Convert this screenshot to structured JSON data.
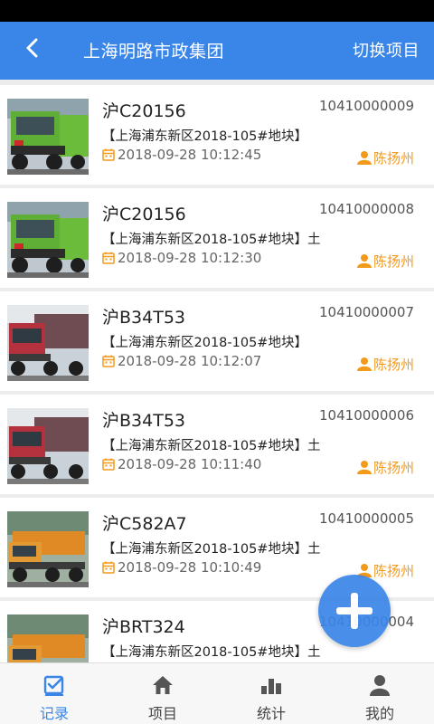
{
  "header": {
    "title": "上海明路市政集团",
    "switch_label": "切换项目"
  },
  "records": [
    {
      "plate": "沪C20156",
      "code": "10410000009",
      "site": "【上海浦东新区2018-105#地块】",
      "time": "2018-09-28 10:12:45",
      "person": "陈扬州",
      "photo": "green-truck"
    },
    {
      "plate": "沪C20156",
      "code": "10410000008",
      "site": "【上海浦东新区2018-105#地块】土",
      "time": "2018-09-28 10:12:30",
      "person": "陈扬州",
      "photo": "green-truck"
    },
    {
      "plate": "沪B34T53",
      "code": "10410000007",
      "site": "【上海浦东新区2018-105#地块】",
      "time": "2018-09-28 10:12:07",
      "person": "陈扬州",
      "photo": "red-truck"
    },
    {
      "plate": "沪B34T53",
      "code": "10410000006",
      "site": "【上海浦东新区2018-105#地块】土",
      "time": "2018-09-28 10:11:40",
      "person": "陈扬州",
      "photo": "red-truck"
    },
    {
      "plate": "沪C582A7",
      "code": "10410000005",
      "site": "【上海浦东新区2018-105#地块】土",
      "time": "2018-09-28 10:10:49",
      "person": "陈扬州",
      "photo": "orange-truck"
    },
    {
      "plate": "沪BRT324",
      "code": "10410000004",
      "site": "【上海浦东新区2018-105#地块】土",
      "time": "",
      "person": "",
      "photo": "orange-truck"
    }
  ],
  "tabs": [
    {
      "label": "记录",
      "icon": "check-square-icon",
      "active": true
    },
    {
      "label": "项目",
      "icon": "home-icon",
      "active": false
    },
    {
      "label": "统计",
      "icon": "bar-chart-icon",
      "active": false
    },
    {
      "label": "我的",
      "icon": "user-icon",
      "active": false
    }
  ],
  "colors": {
    "primary": "#3a86e8",
    "accent": "#f29a1c",
    "background": "#ececec"
  }
}
